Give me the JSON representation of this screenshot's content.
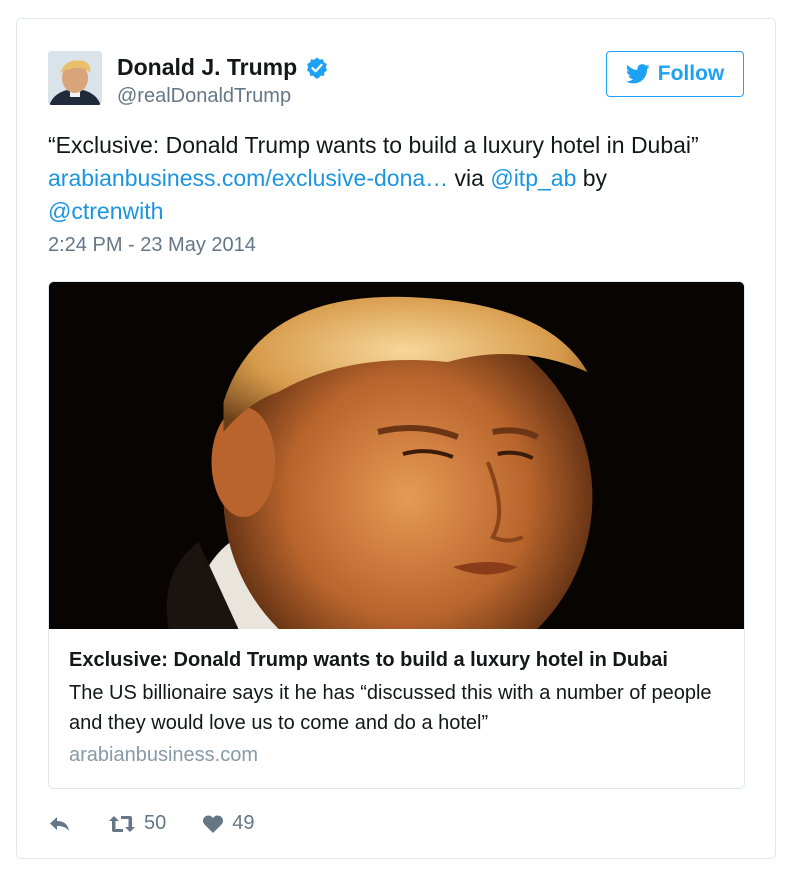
{
  "tweet": {
    "author": {
      "display_name": "Donald J. Trump",
      "handle": "@realDonaldTrump",
      "verified": true
    },
    "follow_label": "Follow",
    "text": {
      "quote": "“Exclusive: Donald Trump wants to build a luxury hotel in Dubai”",
      "link": "arabianbusiness.com/exclusive-dona…",
      "via": "via",
      "via_handle": "@itp_ab",
      "by": "by",
      "by_handle": "@ctrenwith"
    },
    "timestamp": "2:24 PM - 23 May 2014",
    "card": {
      "title": "Exclusive: Donald Trump wants to build a luxury hotel in Dubai",
      "description": "The US billionaire says it he has “discussed this with a number of people and they would love us to come and do a hotel”",
      "domain": "arabianbusiness.com"
    },
    "actions": {
      "retweet_count": "50",
      "like_count": "49"
    }
  },
  "colors": {
    "accent": "#1da1f2",
    "link": "#1b95e0",
    "secondary_text": "#657786",
    "border": "#e1e8ed"
  },
  "icons": [
    "verified-icon",
    "twitter-bird-icon",
    "reply-icon",
    "retweet-icon",
    "heart-icon"
  ]
}
